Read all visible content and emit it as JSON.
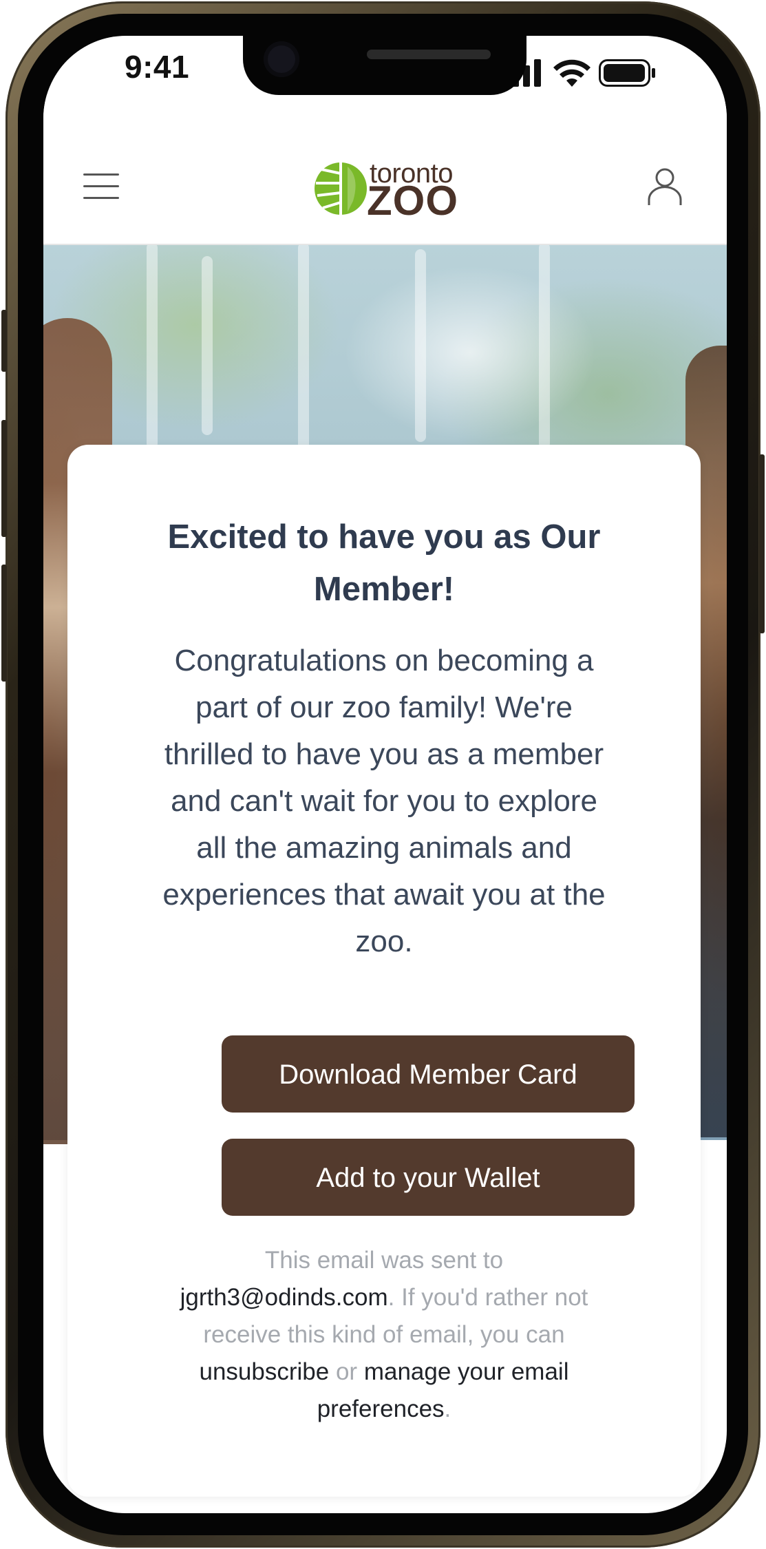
{
  "status_bar": {
    "time": "9:41"
  },
  "header": {
    "logo_top": "toronto",
    "logo_bottom": "ZOO",
    "brand_color": "#7ab929",
    "brand_text_color": "#4a3228",
    "menu_icon": "hamburger-menu-icon",
    "account_icon": "user-account-icon"
  },
  "card": {
    "title": "Excited to have you as Our Member!",
    "body": "Congratulations on becoming a part of our zoo family! We're thrilled to have you as a member and can't wait for you to explore all the amazing animals and experiences that await you at the zoo.",
    "buttons": {
      "download_member_card": "Download Member Card",
      "add_to_wallet": "Add to your Wallet"
    },
    "button_color": "#533a2d",
    "footer": {
      "sent_to_prefix": "This email was sent to",
      "email": "jgrth3@odinds.com",
      "opt_out_text": ". If you'd rather not receive this kind of email, you can",
      "unsubscribe_link": "unsubscribe",
      "or_text": "or",
      "manage_prefs_link": "manage your email preferences",
      "period": "."
    }
  }
}
